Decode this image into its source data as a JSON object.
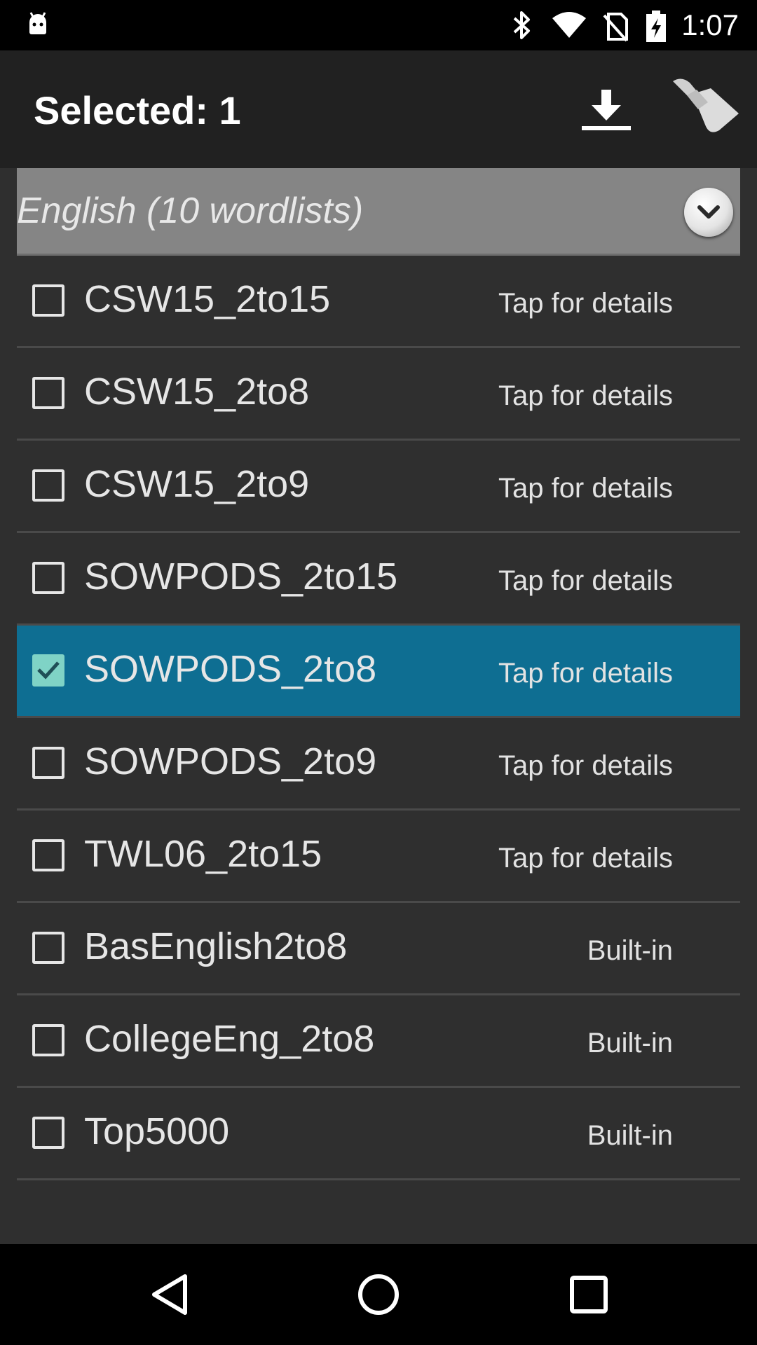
{
  "status_bar": {
    "time": "1:07",
    "icons": [
      "android-debug-icon",
      "bluetooth-icon",
      "wifi-icon",
      "no-sim-icon",
      "battery-charging-icon"
    ]
  },
  "app_bar": {
    "title": "Selected: 1",
    "actions": [
      {
        "name": "download-icon"
      },
      {
        "name": "broom-icon"
      }
    ]
  },
  "group": {
    "title": "English (10 wordlists)",
    "expand_icon": "chevron-down-icon"
  },
  "wordlists": [
    {
      "name": "CSW15_2to15",
      "detail": "Tap for details",
      "checked": false
    },
    {
      "name": "CSW15_2to8",
      "detail": "Tap for details",
      "checked": false
    },
    {
      "name": "CSW15_2to9",
      "detail": "Tap for details",
      "checked": false
    },
    {
      "name": "SOWPODS_2to15",
      "detail": "Tap for details",
      "checked": false
    },
    {
      "name": "SOWPODS_2to8",
      "detail": "Tap for details",
      "checked": true
    },
    {
      "name": "SOWPODS_2to9",
      "detail": "Tap for details",
      "checked": false
    },
    {
      "name": "TWL06_2to15",
      "detail": "Tap for details",
      "checked": false
    },
    {
      "name": "BasEnglish2to8",
      "detail": "Built-in",
      "checked": false
    },
    {
      "name": "CollegeEng_2to8",
      "detail": "Built-in",
      "checked": false
    },
    {
      "name": "Top5000",
      "detail": "Built-in",
      "checked": false
    }
  ],
  "nav_bar": {
    "buttons": [
      "back-icon",
      "home-icon",
      "recents-icon"
    ]
  },
  "colors": {
    "selected_row": "#0e6e92",
    "checkbox_checked": "#7fd3c6",
    "app_bar": "#212121",
    "group_header": "#858585"
  }
}
